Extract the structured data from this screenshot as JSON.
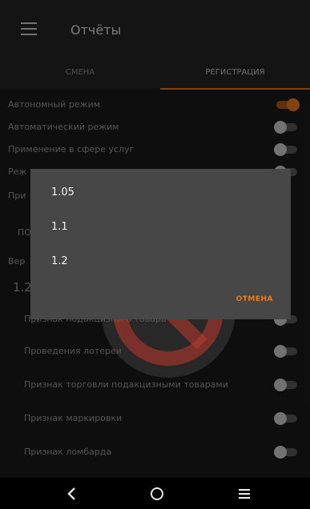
{
  "app": {
    "title": "Отчёты"
  },
  "tabs": [
    {
      "label": "СМЕНА",
      "selected": false
    },
    {
      "label": "РЕГИСТРАЦИЯ",
      "selected": true
    }
  ],
  "settings": [
    {
      "label": "Автономный режим",
      "on": true
    },
    {
      "label": "Автоматический режим",
      "on": false
    },
    {
      "label": "Применение в сфере услуг",
      "on": false
    },
    {
      "label": "Реж",
      "on": false
    },
    {
      "label": "При",
      "on": false
    },
    {
      "label": "ПО",
      "on": false
    },
    {
      "label": "Вер",
      "on": false
    },
    {
      "label": "1.2",
      "on": false
    },
    {
      "label": "Признак подакцизного товара",
      "on": false
    },
    {
      "label": "Проведения лотереи",
      "on": false
    },
    {
      "label": "Признак торговли подакцизными товарами",
      "on": false
    },
    {
      "label": "Признак маркировки",
      "on": false
    },
    {
      "label": "Признак ломбарда",
      "on": false
    }
  ],
  "dialog": {
    "options": [
      "1.05",
      "1.1",
      "1.2"
    ],
    "cancel_label": "ОТМЕНА"
  },
  "colors": {
    "accent": "#f07a1a",
    "dialog_bg": "#474747",
    "appbar_bg": "#262626",
    "watermark": "#c0392b"
  },
  "navbar": {
    "icons": [
      "back-icon",
      "home-icon",
      "recent-apps-icon"
    ]
  }
}
